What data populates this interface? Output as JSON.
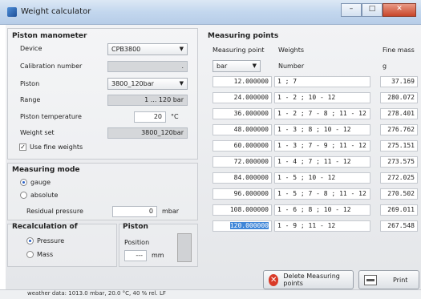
{
  "window": {
    "title": "Weight calculator"
  },
  "piston_manometer": {
    "title": "Piston manometer",
    "device_label": "Device",
    "device_value": "CPB3800",
    "calib_label": "Calibration number",
    "calib_value": ".",
    "piston_label": "Piston",
    "piston_value": "3800_120bar",
    "range_label": "Range",
    "range_value": "1 ... 120 bar",
    "temp_label": "Piston temperature",
    "temp_value": "20",
    "temp_unit": "°C",
    "weightset_label": "Weight set",
    "weightset_value": "3800_120bar",
    "fine_weights_label": "Use fine weights",
    "fine_weights_checked": true
  },
  "measuring_mode": {
    "title": "Measuring mode",
    "gauge_label": "gauge",
    "absolute_label": "absolute",
    "selected": "gauge",
    "residual_label": "Residual pressure",
    "residual_value": "0",
    "residual_unit": "mbar"
  },
  "recalculation": {
    "title": "Recalculation of",
    "pressure_label": "Pressure",
    "mass_label": "Mass",
    "selected": "Pressure"
  },
  "piston_box": {
    "title": "Piston",
    "position_label": "Position",
    "position_value": "---",
    "position_unit": "mm"
  },
  "measuring_points": {
    "title": "Measuring points",
    "col_point": "Measuring point",
    "col_weights": "Weights",
    "col_fine": "Fine mass",
    "unit_point": "bar",
    "unit_weights": "Number",
    "unit_fine": "g",
    "rows": [
      {
        "point": "12.000000",
        "weights": "1 ; 7",
        "fine": "37.169"
      },
      {
        "point": "24.000000",
        "weights": "1 - 2 ; 10 - 12",
        "fine": "280.072"
      },
      {
        "point": "36.000000",
        "weights": "1 - 2 ; 7 - 8 ; 11 - 12",
        "fine": "278.401"
      },
      {
        "point": "48.000000",
        "weights": "1 - 3 ; 8 ; 10 - 12",
        "fine": "276.762"
      },
      {
        "point": "60.000000",
        "weights": "1 - 3 ; 7 - 9 ; 11 - 12",
        "fine": "275.151"
      },
      {
        "point": "72.000000",
        "weights": "1 - 4 ; 7 ; 11 - 12",
        "fine": "273.575"
      },
      {
        "point": "84.000000",
        "weights": "1 - 5 ; 10 - 12",
        "fine": "272.025"
      },
      {
        "point": "96.000000",
        "weights": "1 - 5 ; 7 - 8 ; 11 - 12",
        "fine": "270.502"
      },
      {
        "point": "108.000000",
        "weights": "1 - 6 ; 8 ; 10 - 12",
        "fine": "269.011"
      },
      {
        "point": "120.000000",
        "weights": "1 - 9 ; 11 - 12",
        "fine": "267.548"
      }
    ]
  },
  "buttons": {
    "delete_label": "Delete Measuring points",
    "print_label": "Print"
  },
  "status": {
    "text": "weather data: 1013.0 mbar, 20.0 °C, 40 % rel. LF"
  }
}
